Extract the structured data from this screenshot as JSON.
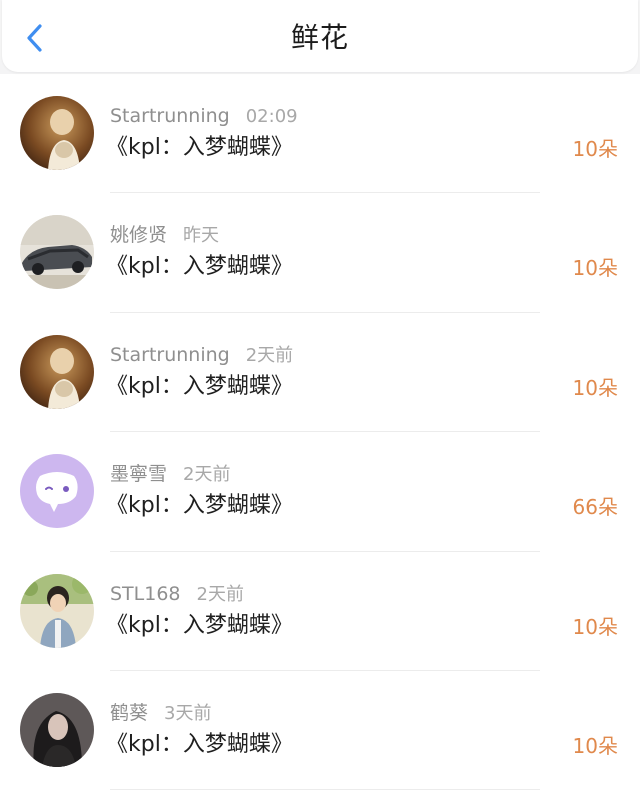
{
  "header": {
    "back_icon": "chevron-left-icon",
    "title": "鲜花"
  },
  "colors": {
    "accent_blue": "#3f8ef0",
    "count_orange": "#e0894c"
  },
  "rows": [
    {
      "name": "Startrunning",
      "time": "02:09",
      "gift": "《kpl：入梦蝴蝶》",
      "count": "10朵",
      "avatar": "photo-boy-warm"
    },
    {
      "name": "姚修贤",
      "time": "昨天",
      "gift": "《kpl：入梦蝴蝶》",
      "count": "10朵",
      "avatar": "photo-car"
    },
    {
      "name": "Startrunning",
      "time": "2天前",
      "gift": "《kpl：入梦蝴蝶》",
      "count": "10朵",
      "avatar": "photo-boy-warm"
    },
    {
      "name": "墨寧雪",
      "time": "2天前",
      "gift": "《kpl：入梦蝴蝶》",
      "count": "66朵",
      "avatar": "chat-bubble-icon"
    },
    {
      "name": "STL168",
      "time": "2天前",
      "gift": "《kpl：入梦蝴蝶》",
      "count": "10朵",
      "avatar": "photo-boy-denim"
    },
    {
      "name": "鹤葵",
      "time": "3天前",
      "gift": "《kpl：入梦蝴蝶》",
      "count": "10朵",
      "avatar": "photo-girl-dark"
    }
  ]
}
